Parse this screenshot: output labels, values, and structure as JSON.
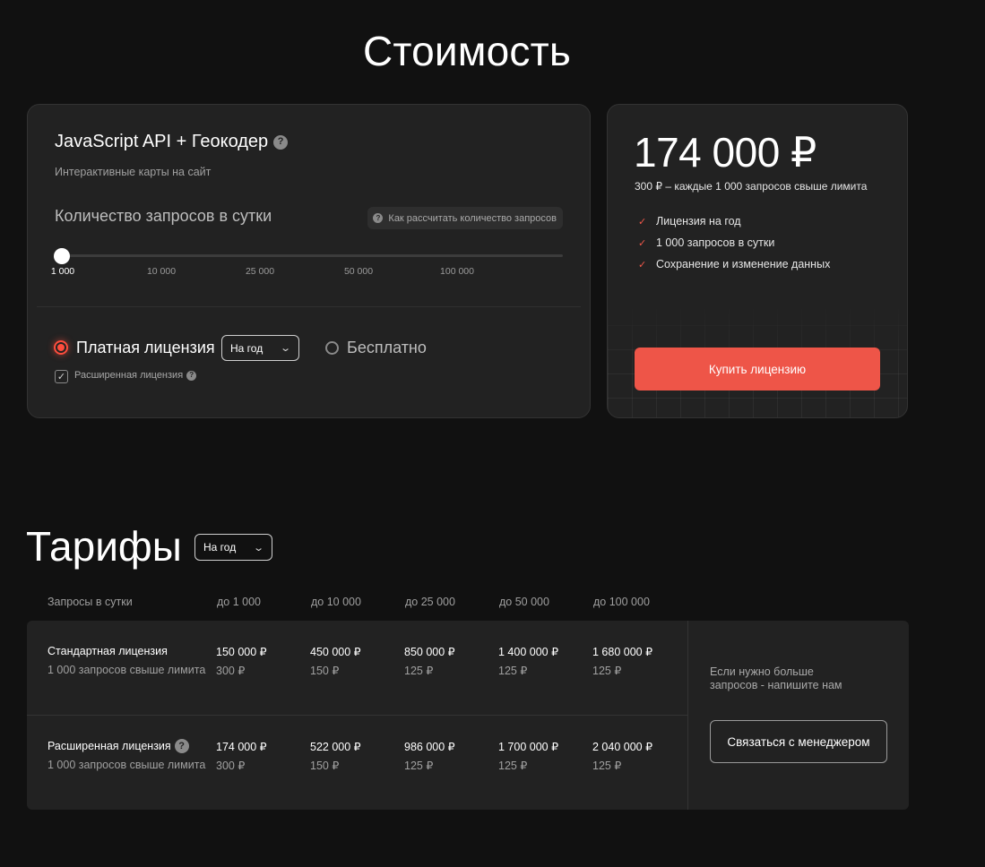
{
  "page": {
    "title": "Стоимость"
  },
  "calculator": {
    "product_title": "JavaScript API + Геокодер",
    "product_subtitle": "Интерактивные карты на сайт",
    "requests_label": "Количество запросов в сутки",
    "how_to_calc": "Как рассчитать количество запросов",
    "slider": {
      "ticks": [
        "1 000",
        "10 000",
        "25 000",
        "50 000",
        "100 000"
      ],
      "selected": "1 000"
    },
    "paid_label": "Платная лицензия",
    "period_select": "На год",
    "free_label": "Бесплатно",
    "extended_label": "Расширенная лицензия",
    "extended_checked": true
  },
  "price_card": {
    "price": "174 000 ₽",
    "note": "300 ₽ – каждые 1 000 запросов свыше лимита",
    "features": [
      "Лицензия на год",
      "1 000 запросов в сутки",
      "Сохранение и изменение данных"
    ],
    "buy_label": "Купить лицензию"
  },
  "tariffs": {
    "title": "Тарифы",
    "period_select": "На год",
    "headers": [
      "Запросы в сутки",
      "до 1 000",
      "до 10 000",
      "до 25 000",
      "до 50 000",
      "до 100 000"
    ],
    "rows": [
      {
        "name": "Стандартная лицензия",
        "sub": "1 000 запросов свыше лимита",
        "prices": [
          "150 000 ₽",
          "450 000 ₽",
          "850 000 ₽",
          "1 400 000 ₽",
          "1 680 000 ₽"
        ],
        "extras": [
          "300 ₽",
          "150 ₽",
          "125 ₽",
          "125 ₽",
          "125 ₽"
        ]
      },
      {
        "name": "Расширенная лицензия",
        "sub": "1 000 запросов свыше лимита",
        "prices": [
          "174 000 ₽",
          "522 000 ₽",
          "986 000 ₽",
          "1 700 000 ₽",
          "2 040 000 ₽"
        ],
        "extras": [
          "300 ₽",
          "150 ₽",
          "125 ₽",
          "125 ₽",
          "125 ₽"
        ]
      }
    ],
    "contact_note": "Если нужно больше запросов - напишите нам",
    "contact_button": "Связаться с менеджером"
  },
  "colors": {
    "background": "#111111",
    "card": "#222222",
    "accent": "#ee5548"
  },
  "icons": {
    "help": "question-circle-icon",
    "check": "check-icon",
    "chevron": "chevron-down-icon"
  }
}
